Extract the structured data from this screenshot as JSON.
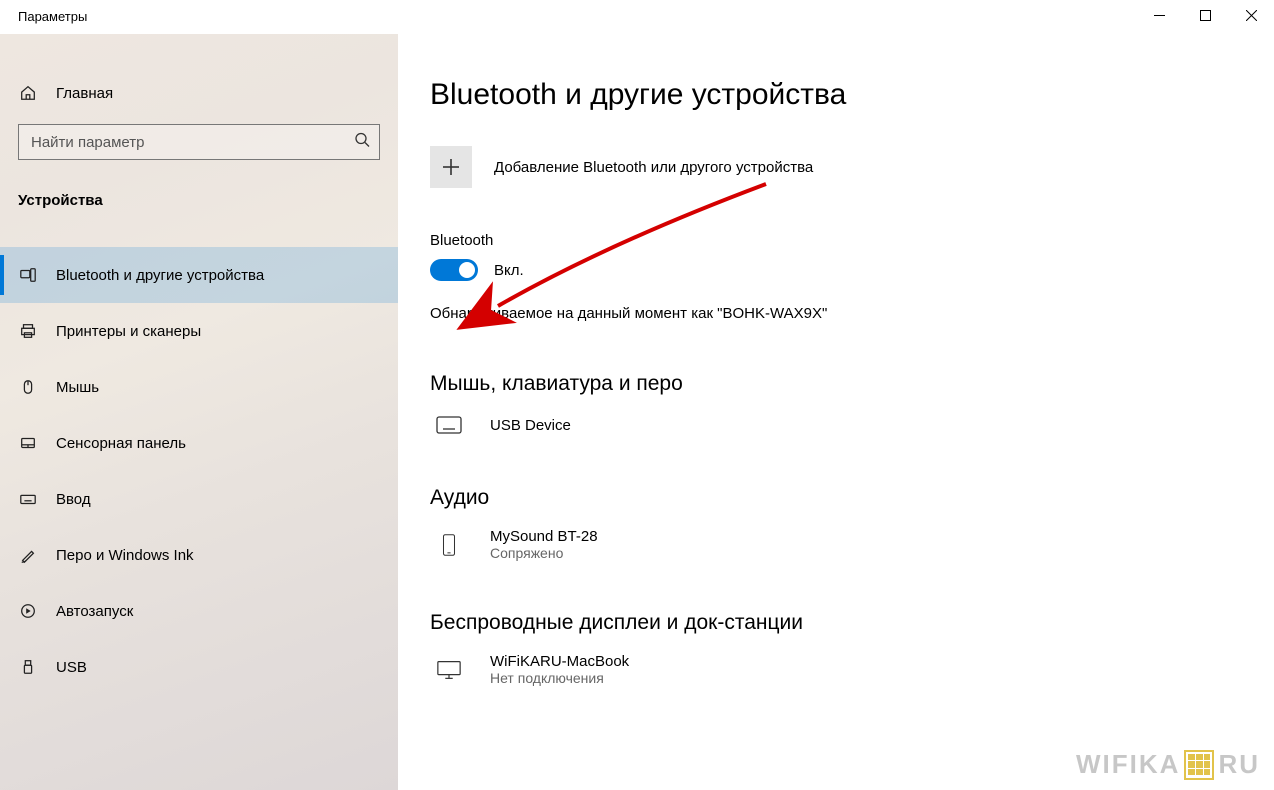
{
  "titlebar": {
    "title": "Параметры"
  },
  "sidebar": {
    "home": "Главная",
    "search_placeholder": "Найти параметр",
    "section": "Устройства",
    "items": [
      {
        "label": "Bluetooth и другие устройства",
        "selected": true
      },
      {
        "label": "Принтеры и сканеры"
      },
      {
        "label": "Мышь"
      },
      {
        "label": "Сенсорная панель"
      },
      {
        "label": "Ввод"
      },
      {
        "label": "Перо и Windows Ink"
      },
      {
        "label": "Автозапуск"
      },
      {
        "label": "USB"
      }
    ]
  },
  "main": {
    "title": "Bluetooth и другие устройства",
    "add_label": "Добавление Bluetooth или другого устройства",
    "bt_heading": "Bluetooth",
    "toggle_state": "Вкл.",
    "discoverable": "Обнаруживаемое на данный момент как \"BOHK-WAX9X\"",
    "section_mouse": "Мышь, клавиатура и перо",
    "dev_usb": {
      "name": "USB Device"
    },
    "section_audio": "Аудио",
    "dev_audio": {
      "name": "MySound BT-28",
      "sub": "Сопряжено"
    },
    "section_display": "Беспроводные дисплеи и док-станции",
    "dev_display": {
      "name": "WiFiKARU-MacBook",
      "sub": "Нет подключения"
    }
  },
  "watermark": {
    "text": "WIFIKA",
    "suffix": "RU"
  }
}
